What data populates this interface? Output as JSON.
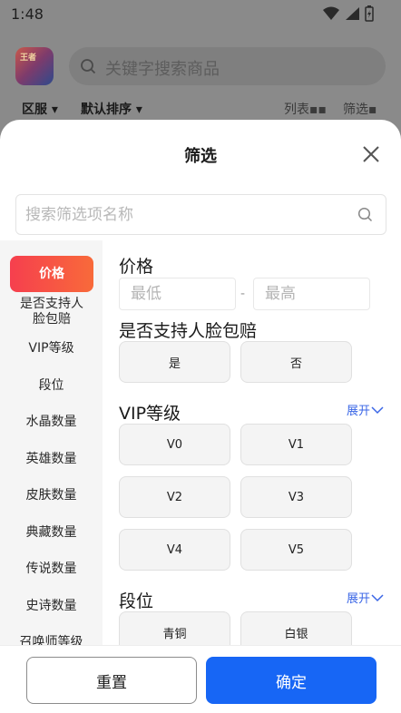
{
  "status_bar": {
    "time": "1:48"
  },
  "background": {
    "game_icon_text": "王者",
    "search_placeholder": "关键字搜索商品",
    "filters": {
      "region": "区服",
      "sort": "默认排序",
      "list": "列表",
      "filter": "筛选"
    }
  },
  "sheet": {
    "title": "筛选",
    "search_placeholder": "搜索筛选项名称",
    "nav": [
      {
        "label": "价格",
        "active": true
      },
      {
        "label": "是否支持人脸包赔"
      },
      {
        "label": "VIP等级"
      },
      {
        "label": "段位"
      },
      {
        "label": "水晶数量"
      },
      {
        "label": "英雄数量"
      },
      {
        "label": "皮肤数量"
      },
      {
        "label": "典藏数量"
      },
      {
        "label": "传说数量"
      },
      {
        "label": "史诗数量"
      },
      {
        "label": "召唤师等级"
      }
    ],
    "sections": {
      "price": {
        "title": "价格",
        "min_placeholder": "最低",
        "max_placeholder": "最高",
        "separator": "-"
      },
      "face": {
        "title": "是否支持人脸包赔",
        "options": [
          "是",
          "否"
        ]
      },
      "vip": {
        "title": "VIP等级",
        "expand": "展开",
        "options": [
          "V0",
          "V1",
          "V2",
          "V3",
          "V4",
          "V5"
        ]
      },
      "rank": {
        "title": "段位",
        "expand": "展开",
        "options": [
          "青铜",
          "白银"
        ]
      }
    },
    "footer": {
      "reset": "重置",
      "confirm": "确定"
    }
  },
  "colors": {
    "accent_blue": "#1766f5",
    "active_red": "#f63f4e",
    "link_blue": "#3a66e6"
  }
}
